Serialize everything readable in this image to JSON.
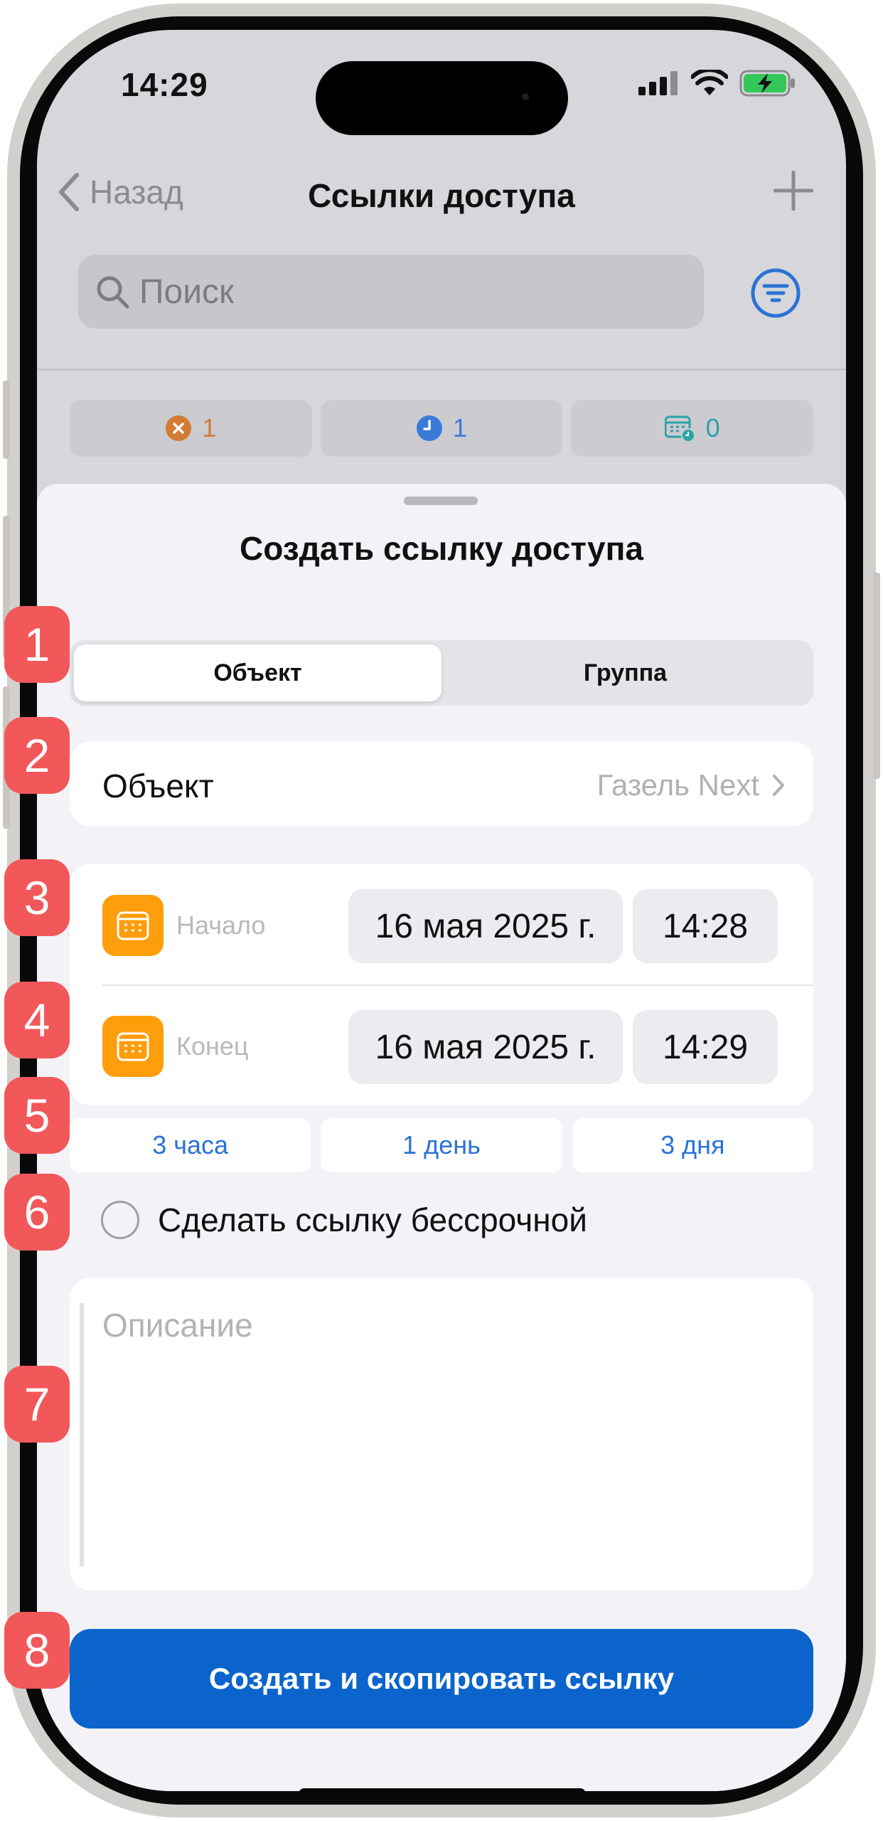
{
  "status_bar": {
    "time": "14:29"
  },
  "nav": {
    "back_label": "Назад",
    "title": "Ссылки доступа"
  },
  "search": {
    "placeholder": "Поиск"
  },
  "stats": [
    {
      "icon": "cancelled-icon",
      "count": "1",
      "color": "#d27b34"
    },
    {
      "icon": "clock-icon",
      "count": "1",
      "color": "#3a7ad9"
    },
    {
      "icon": "calendar-clock-icon",
      "count": "0",
      "color": "#2aa3a8"
    }
  ],
  "sheet": {
    "title": "Создать ссылку доступа",
    "segments": [
      "Объект",
      "Группа"
    ],
    "object_row": {
      "label": "Объект",
      "value": "Газель Next"
    },
    "start": {
      "label": "Начало",
      "date": "16 мая 2025 г.",
      "time": "14:28"
    },
    "end": {
      "label": "Конец",
      "date": "16 мая 2025 г.",
      "time": "14:29"
    },
    "quick_durations": [
      "3 часа",
      "1 день",
      "3 дня"
    ],
    "forever_label": "Сделать ссылку бессрочной",
    "description_placeholder": "Описание",
    "submit_label": "Создать и скопировать ссылку"
  },
  "annotations": [
    "1",
    "2",
    "3",
    "4",
    "5",
    "6",
    "7",
    "8"
  ],
  "colors": {
    "accent": "#0a64cc",
    "link": "#2a72d6",
    "calendar": "#ff9d0a",
    "marker": "#f2575a"
  }
}
